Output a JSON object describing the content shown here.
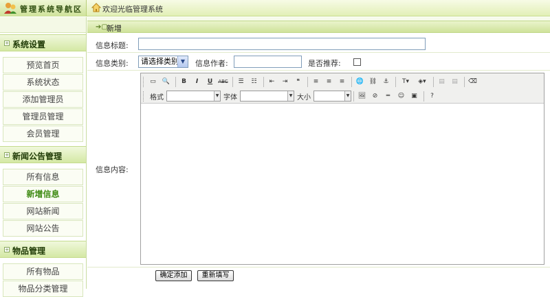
{
  "header": {
    "brand_title": "管理系统导航区",
    "welcome": "欢迎光临管理系统"
  },
  "sidebar": {
    "sections": [
      {
        "title": "系统设置",
        "items": [
          "预览首页",
          "系统状态",
          "添加管理员",
          "管理员管理",
          "会员管理"
        ]
      },
      {
        "title": "新闻公告管理",
        "items": [
          "所有信息",
          "新增信息",
          "网站新闻",
          "网站公告"
        ]
      },
      {
        "title": "物品管理",
        "items": [
          "所有物品",
          "物品分类管理"
        ]
      }
    ],
    "active_item": "新增信息"
  },
  "main": {
    "breadcrumb": "新增",
    "form": {
      "title_label": "信息标题:",
      "title_value": "",
      "category_label": "信息类别:",
      "category_selected": "请选择类别",
      "author_label": "信息作者:",
      "author_value": "",
      "recommend_label": "是否推荐:",
      "recommend_checked": false,
      "content_label": "信息内容:"
    },
    "editor_toolbar": {
      "format_label": "格式",
      "font_label": "字体",
      "size_label": "大小"
    },
    "buttons": {
      "submit": "确定添加",
      "reset": "重新填写"
    }
  },
  "colors": {
    "accent_green": "#cfe29a",
    "active_text": "#3e8a12"
  }
}
